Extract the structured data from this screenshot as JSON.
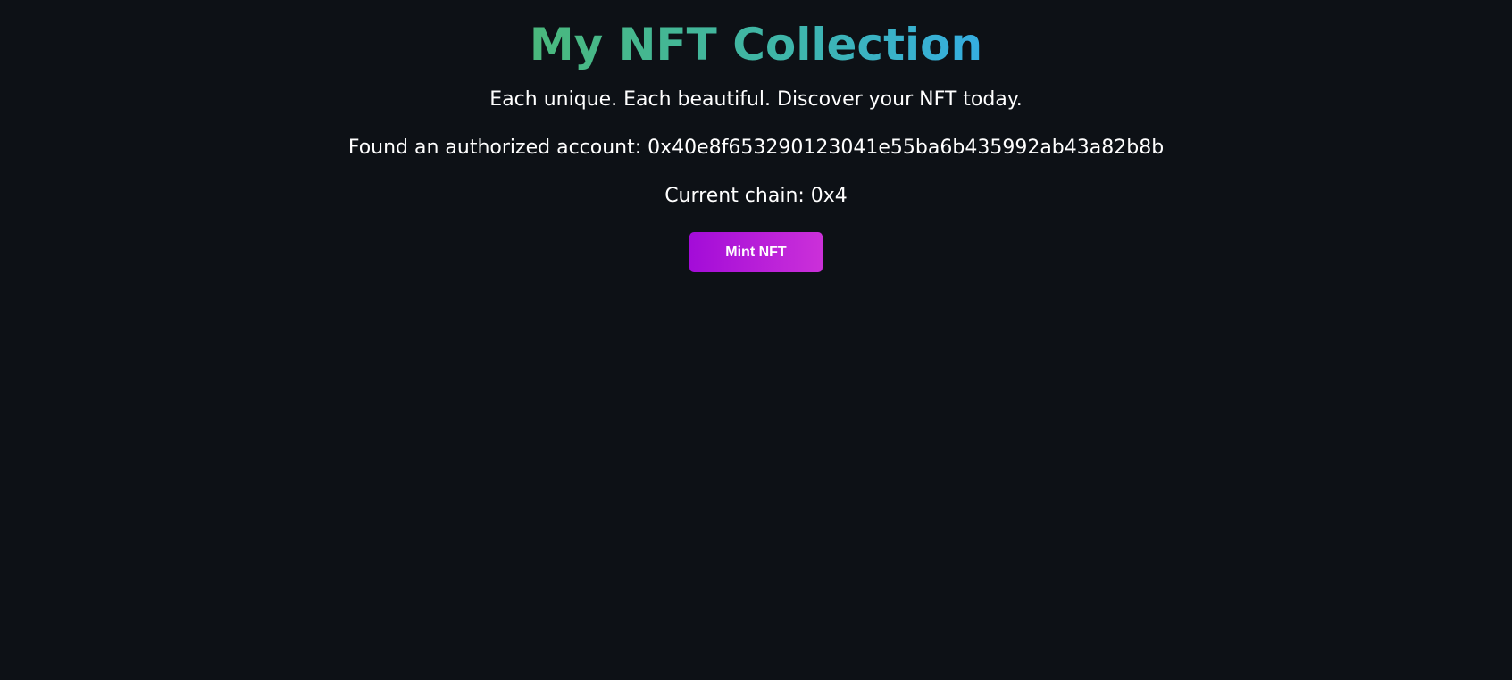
{
  "header": {
    "title": "My NFT Collection",
    "tagline": "Each unique. Each beautiful. Discover your NFT today."
  },
  "status": {
    "account": "Found an authorized account: 0x40e8f653290123041e55ba6b435992ab43a82b8b",
    "chain": "Current chain: 0x4"
  },
  "actions": {
    "mint_label": "Mint NFT"
  },
  "colors": {
    "background": "#0d1116",
    "title_gradient_start": "#4ab87c",
    "title_gradient_end": "#35aee2",
    "button_gradient_start": "#a30cd8",
    "button_gradient_end": "#cb30d9"
  }
}
